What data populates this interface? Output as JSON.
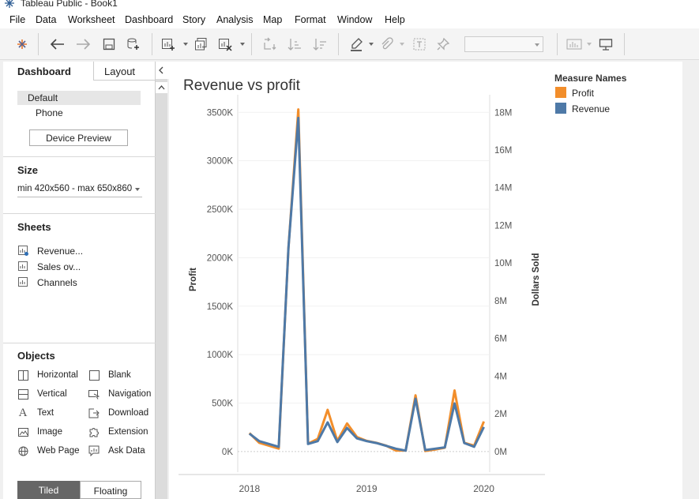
{
  "window": {
    "title": "Tableau Public - Book1"
  },
  "menu": [
    "File",
    "Data",
    "Worksheet",
    "Dashboard",
    "Story",
    "Analysis",
    "Map",
    "Format",
    "Window",
    "Help"
  ],
  "left_panel": {
    "tabs": {
      "dashboard": "Dashboard",
      "layout": "Layout"
    },
    "device": {
      "default": "Default",
      "phone": "Phone",
      "preview_button": "Device Preview"
    },
    "size": {
      "title": "Size",
      "value": "min 420x560 - max 650x860"
    },
    "sheets": {
      "title": "Sheets",
      "items": [
        "Revenue...",
        "Sales ov...",
        "Channels"
      ]
    },
    "objects": {
      "title": "Objects",
      "items": [
        {
          "label": "Horizontal",
          "icon": "horizontal-container-icon"
        },
        {
          "label": "Blank",
          "icon": "blank-icon"
        },
        {
          "label": "Vertical",
          "icon": "vertical-container-icon"
        },
        {
          "label": "Navigation",
          "icon": "navigation-icon"
        },
        {
          "label": "Text",
          "icon": "text-icon"
        },
        {
          "label": "Download",
          "icon": "download-icon"
        },
        {
          "label": "Image",
          "icon": "image-icon"
        },
        {
          "label": "Extension",
          "icon": "extension-icon"
        },
        {
          "label": "Web Page",
          "icon": "web-page-icon"
        },
        {
          "label": "Ask Data",
          "icon": "ask-data-icon"
        }
      ]
    },
    "mode": {
      "tiled": "Tiled",
      "floating": "Floating",
      "active": "Tiled"
    }
  },
  "colors": {
    "profit": "#f28e2b",
    "revenue": "#4e79a7"
  },
  "chart_data": {
    "type": "line",
    "title": "Revenue vs profit",
    "ylabel": "Profit",
    "y2label": "Dollars Sold",
    "x_ticks": [
      "2018",
      "2019",
      "2020"
    ],
    "y_ticks": [
      "0K",
      "500K",
      "1000K",
      "1500K",
      "2000K",
      "2500K",
      "3000K",
      "3500K"
    ],
    "y2_ticks": [
      "0M",
      "2M",
      "4M",
      "6M",
      "8M",
      "10M",
      "12M",
      "14M",
      "16M",
      "18M"
    ],
    "ylim": [
      0,
      3500000
    ],
    "y2lim": [
      0,
      18000000
    ],
    "x": [
      2018.0,
      2018.083,
      2018.25,
      2018.333,
      2018.417,
      2018.5,
      2018.583,
      2018.667,
      2018.75,
      2018.833,
      2018.917,
      2019.0,
      2019.083,
      2019.167,
      2019.25,
      2019.333,
      2019.417,
      2019.5,
      2019.583,
      2019.667,
      2019.75,
      2019.833,
      2019.917,
      2020.0
    ],
    "legend": {
      "title": "Measure Names",
      "position": "top-right"
    },
    "series": [
      {
        "name": "Profit",
        "axis": "left",
        "values": [
          190000,
          90000,
          30000,
          2100000,
          3530000,
          80000,
          130000,
          430000,
          110000,
          290000,
          150000,
          110000,
          90000,
          60000,
          10000,
          10000,
          580000,
          5000,
          20000,
          40000,
          630000,
          90000,
          60000,
          310000
        ]
      },
      {
        "name": "Revenue",
        "axis": "right",
        "values": [
          950000,
          550000,
          250000,
          10800000,
          17700000,
          400000,
          550000,
          1550000,
          500000,
          1250000,
          700000,
          550000,
          450000,
          300000,
          150000,
          50000,
          2800000,
          80000,
          150000,
          220000,
          2550000,
          450000,
          250000,
          1300000
        ]
      }
    ]
  }
}
